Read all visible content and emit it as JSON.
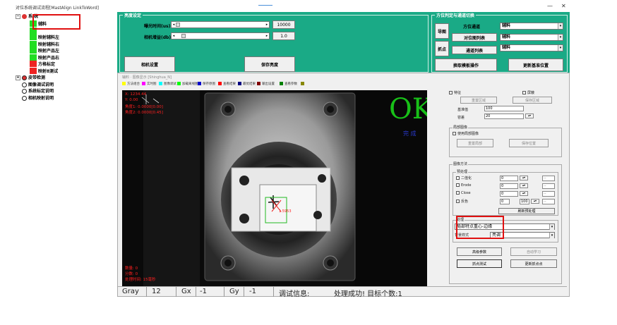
{
  "window": {
    "title": "对位系统调试流程[MastAlign LinkToWord]",
    "minimize": "—",
    "close": "✕"
  },
  "tree": {
    "root_label": "系 统",
    "items": [
      {
        "label": "辅料",
        "color": "#22dd22"
      },
      {
        "label": "",
        "color": "#22dd22"
      },
      {
        "label": "映射辅料左",
        "color": "#22dd22"
      },
      {
        "label": "映射辅料右",
        "color": "#22dd22"
      },
      {
        "label": "映射产品左",
        "color": "#22dd22"
      },
      {
        "label": "映射产品右",
        "color": "#22dd22"
      },
      {
        "label": "方格标定",
        "color": "#ee2222"
      },
      {
        "label": "映射8测试",
        "color": "#ee2222"
      }
    ],
    "after": [
      {
        "label": "皮带检测",
        "expander": "+"
      },
      {
        "label": "图像调试说明",
        "expander": ""
      },
      {
        "label": "系统标定说明",
        "expander": ""
      },
      {
        "label": "相机映射说明",
        "expander": ""
      }
    ]
  },
  "top": {
    "left_group_title": "亮度设定",
    "exposure_label": "曝光时间(us)",
    "exposure_value": "10000",
    "gain_label": "相机增益(db)",
    "gain_value": "1.0",
    "camera_settings": "相机设置",
    "save_brightness": "保存亮度",
    "right_group_title": "方位判定与通道切换",
    "import_btn": "导图",
    "grab_btn": "抓点",
    "param_sel_label": "方位通道",
    "param_sel_value": "辅料",
    "align_list_btn": "对位图列表",
    "align_list_value": "辅料",
    "channel_list_btn": "通道列表",
    "channel_list_value": "辅料",
    "template_btn": "换取模板操作",
    "update_template_btn": "更新基准位置"
  },
  "panel": {
    "header": "辅料 · 图像显示 [Shinghua_N]",
    "legend": [
      {
        "label": "方法组合",
        "color": "#ffff00"
      },
      {
        "label": "实时图",
        "color": "#ff00ff"
      },
      {
        "label": "图像调试",
        "color": "#00ffff"
      },
      {
        "label": "加载离线图",
        "color": "#00ff00"
      },
      {
        "label": "保存原图",
        "color": "#0000cc"
      },
      {
        "label": "查看结果",
        "color": "#ff0000"
      },
      {
        "label": "最优结果",
        "color": "#000080"
      },
      {
        "label": "输出设置",
        "color": "#800000"
      },
      {
        "label": "查看参数",
        "color": "#008000"
      },
      {
        "label": "",
        "color": "#888800"
      }
    ],
    "overlay": {
      "ok_text": "OK",
      "ok_sub": "完 成",
      "line1": "X: 1234.44",
      "line2": "Y: 0.00",
      "line3": "角度1: 0.0000[0.00]",
      "line4": "角度2: 0.0000[0.45]",
      "target_label": "1.5953",
      "bottom1": "数量: 0",
      "bottom2": "分数: 0",
      "bottom3": "处理时间: 15毫秒"
    },
    "status": {
      "gray_label": "Gray",
      "gray_value": "12",
      "gx_label": "Gx",
      "gx_value": "-1",
      "gy_label": "Gy",
      "gy_value": "-1",
      "debug_label": "调试信息:",
      "debug_value": "处理成功! 目标个数:1"
    }
  },
  "right": {
    "feature_cb": "特征",
    "exclude_cb": "屏蔽",
    "reset_region": "重置区域",
    "save_region": "保存区域",
    "threshold_label": "基准值",
    "threshold_value": "100",
    "tolerance_label": "容差",
    "tolerance_value": "20",
    "local_group": "局部图像",
    "use_local_cb": "使用局部图像",
    "reset_local": "重置局部",
    "save_local": "保存位置",
    "method_group": "图像方法",
    "preprocess_group": "预处理",
    "pre_items": [
      {
        "label": "二值化",
        "value": "0"
      },
      {
        "label": "Erode",
        "value": "0"
      },
      {
        "label": "Close",
        "value": "0"
      },
      {
        "label": "反色",
        "value": "0",
        "value2": "100"
      }
    ],
    "refresh_pre": "刷新预处理",
    "proc_group": "处理",
    "proc_method": "局部特点重心-边缘",
    "bg_label": "背景样式",
    "bg_value": "亮调",
    "advanced_btn": "高级参数",
    "auto_learn_btn": "自动学习",
    "point_test_btn": "抓点测试",
    "update_point_btn": "更新抓点点"
  }
}
